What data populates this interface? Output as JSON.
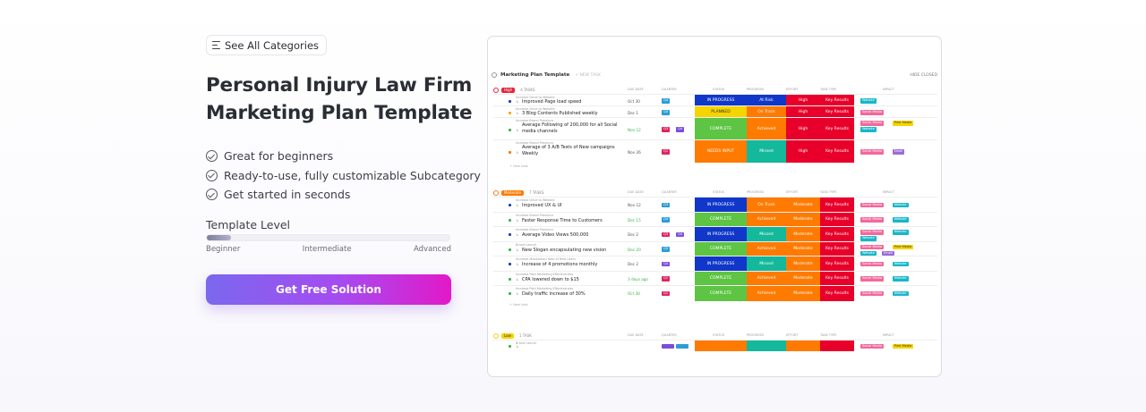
{
  "category_button": {
    "label": "See All Categories"
  },
  "title": "Personal Injury Law Firm Marketing Plan Template",
  "features": [
    "Great for beginners",
    "Ready-to-use, fully customizable Subcategory",
    "Get started in seconds"
  ],
  "template_level": {
    "label": "Template Level",
    "value_fraction": 0.1,
    "ticks": [
      "Beginner",
      "Intermediate",
      "Advanced"
    ]
  },
  "cta": {
    "label": "Get Free Solution"
  },
  "preview": {
    "title": "Marketing Plan Template",
    "subtitle": "+ NEW TASK",
    "hide_closed": "HIDE CLOSED",
    "columns": [
      "DUE DATE",
      "QUARTER",
      "STATUS",
      "PROGRESS",
      "EFFORT",
      "TASK TYPE",
      "IMPACT"
    ],
    "groups": [
      {
        "tag": "High",
        "tag_color": "#e5243b",
        "count": "4 TASKS",
        "rows": [
          {
            "cat": "Increase Drive to Website",
            "name": "Improved Page load speed",
            "dot": "#1f3fb5",
            "date": "Oct 30",
            "date_color": "#555",
            "q": [
              {
                "t": "Q4",
                "c": "#2b9cd8"
              }
            ],
            "status": "IN PROGRESS",
            "status_color": "#1037c9",
            "progress": "At Risk",
            "progress_color": "#1037c9",
            "effort": "High",
            "effort_color": "#e8002a",
            "type": "Key Results",
            "impact": [
              {
                "t": "Website",
                "c": "#18b6c9"
              }
            ]
          },
          {
            "cat": "Increase Drive to Website",
            "name": "3 Blog Contents Published weekly",
            "dot": "#f4a80b",
            "date": "Dec 1",
            "date_color": "#555",
            "q": [
              {
                "t": "Q4",
                "c": "#2b9cd8"
              }
            ],
            "status": "PLANNED",
            "status_color": "#f5d400",
            "progress": "On Track",
            "progress_color": "#ff7a00",
            "effort": "High",
            "effort_color": "#e8002a",
            "type": "Key Results",
            "impact": [
              {
                "t": "Social Media",
                "c": "#f2689b"
              }
            ]
          },
          {
            "cat": "Increase Brand Presence",
            "name": "Average Following of 200,000 for all Social media channels",
            "dot": "#3bb54a",
            "date": "Nov 12",
            "date_color": "#3bb54a",
            "q": [
              {
                "t": "Q3",
                "c": "#e0245e"
              },
              {
                "t": "Q4",
                "c": "#7b4ddb"
              }
            ],
            "status": "COMPLETE",
            "status_color": "#5ec444",
            "progress": "Achieved",
            "progress_color": "#ff7a00",
            "effort": "High",
            "effort_color": "#e8002a",
            "type": "Key Results",
            "impact": [
              {
                "t": "Social Media",
                "c": "#f2689b"
              },
              {
                "t": "Print Media",
                "c": "#f5d400"
              },
              {
                "t": "Website",
                "c": "#18b6c9"
              }
            ]
          },
          {
            "cat": "Increase Brand Presence",
            "name": "Average of 3 A/B Tests of New campaigns Weekly",
            "dot": "#f57c00",
            "date": "Nov 26",
            "date_color": "#555",
            "q": [
              {
                "t": "Q1",
                "c": "#e0245e"
              }
            ],
            "status": "NEEDS INPUT",
            "status_color": "#ff7a00",
            "progress": "Missed",
            "progress_color": "#14b89a",
            "effort": "High",
            "effort_color": "#e8002a",
            "type": "Key Results",
            "impact": [
              {
                "t": "Social Media",
                "c": "#f2689b"
              },
              {
                "t": "Email",
                "c": "#9b6ad8"
              }
            ]
          }
        ]
      },
      {
        "tag": "Moderate",
        "tag_color": "#ff7a00",
        "count": "7 TASKS",
        "rows": [
          {
            "cat": "Increase Drive to Website",
            "name": "Improved UX & UI",
            "dot": "#1f3fb5",
            "date": "Nov 12",
            "date_color": "#555",
            "q": [
              {
                "t": "Q3",
                "c": "#2b9cd8"
              }
            ],
            "status": "IN PROGRESS",
            "status_color": "#1037c9",
            "progress": "On Track",
            "progress_color": "#ff7a00",
            "effort": "Moderate",
            "effort_color": "#ff7a00",
            "type": "Key Results",
            "impact": [
              {
                "t": "Social Media",
                "c": "#f2689b"
              },
              {
                "t": "Website",
                "c": "#18b6c9"
              }
            ]
          },
          {
            "cat": "Increase Brand Presence",
            "name": "Faster Response Time to Customers",
            "dot": "#3bb54a",
            "date": "Dec 15",
            "date_color": "#3bb54a",
            "q": [
              {
                "t": "Q4",
                "c": "#2b9cd8"
              }
            ],
            "status": "COMPLETE",
            "status_color": "#5ec444",
            "progress": "Achieved",
            "progress_color": "#ff7a00",
            "effort": "Moderate",
            "effort_color": "#ff7a00",
            "type": "Key Results",
            "impact": [
              {
                "t": "Social Media",
                "c": "#f2689b"
              },
              {
                "t": "Website",
                "c": "#18b6c9"
              }
            ]
          },
          {
            "cat": "Increase Brand Presence",
            "name": "Average Video Views 500,000",
            "dot": "#1f3fb5",
            "date": "Dec 2",
            "date_color": "#555",
            "q": [
              {
                "t": "Q3",
                "c": "#e0245e"
              },
              {
                "t": "Q4",
                "c": "#7b4ddb"
              }
            ],
            "status": "IN PROGRESS",
            "status_color": "#1037c9",
            "progress": "Missed",
            "progress_color": "#14b89a",
            "effort": "Moderate",
            "effort_color": "#ff7a00",
            "type": "Key Results",
            "impact": [
              {
                "t": "Social Media",
                "c": "#f2689b"
              },
              {
                "t": "Website",
                "c": "#18b6c9"
              },
              {
                "t": "Website",
                "c": "#18b6c9"
              }
            ]
          },
          {
            "cat": "Brand Launch",
            "name": "New Slogan encapsulating new vision",
            "dot": "#3bb54a",
            "date": "Dec 20",
            "date_color": "#3bb54a",
            "q": [
              {
                "t": "Q3",
                "c": "#2b9cd8"
              }
            ],
            "status": "COMPLETE",
            "status_color": "#5ec444",
            "progress": "Achieved",
            "progress_color": "#ff7a00",
            "effort": "Moderate",
            "effort_color": "#ff7a00",
            "type": "Key Results",
            "impact": [
              {
                "t": "Social Media",
                "c": "#f2689b"
              },
              {
                "t": "Print Media",
                "c": "#f5d400"
              },
              {
                "t": "Website",
                "c": "#18b6c9"
              },
              {
                "t": "Email",
                "c": "#9b6ad8"
              }
            ]
          },
          {
            "cat": "Increase Moderation Rate of New Users",
            "name": "Increase of 4 promotions monthly",
            "dot": "#1f3fb5",
            "date": "Dec 2",
            "date_color": "#555",
            "q": [
              {
                "t": "Q4",
                "c": "#7b4ddb"
              }
            ],
            "status": "IN PROGRESS",
            "status_color": "#1037c9",
            "progress": "Missed",
            "progress_color": "#14b89a",
            "effort": "Moderate",
            "effort_color": "#ff7a00",
            "type": "Key Results",
            "impact": [
              {
                "t": "Social Media",
                "c": "#f2689b"
              },
              {
                "t": "Website",
                "c": "#18b6c9"
              }
            ]
          },
          {
            "cat": "Increase Paid Marketing Effectiveness",
            "name": "CPA lowered down to $15",
            "dot": "#3bb54a",
            "date": "3 days ago",
            "date_color": "#3bb54a",
            "q": [
              {
                "t": "Q1",
                "c": "#e0245e"
              }
            ],
            "status": "COMPLETE",
            "status_color": "#5ec444",
            "progress": "Achieved",
            "progress_color": "#ff7a00",
            "effort": "Moderate",
            "effort_color": "#ff7a00",
            "type": "Key Results",
            "impact": [
              {
                "t": "Social Media",
                "c": "#f2689b"
              },
              {
                "t": "Website",
                "c": "#18b6c9"
              }
            ]
          },
          {
            "cat": "Increase Paid Marketing Effectiveness",
            "name": "Daily traffic increase of 30%",
            "dot": "#3bb54a",
            "date": "Oct 30",
            "date_color": "#3bb54a",
            "q": [
              {
                "t": "Q1",
                "c": "#e0245e"
              }
            ],
            "status": "COMPLETE",
            "status_color": "#5ec444",
            "progress": "Achieved",
            "progress_color": "#ff7a00",
            "effort": "Moderate",
            "effort_color": "#ff7a00",
            "type": "Key Results",
            "impact": [
              {
                "t": "Social Media",
                "c": "#f2689b"
              },
              {
                "t": "Website",
                "c": "#18b6c9"
              }
            ]
          }
        ]
      },
      {
        "tag": "Low",
        "tag_color": "#f5d400",
        "count": "1 TASK",
        "rows": [
          {
            "cat": "Brand Launch",
            "name": "",
            "dot": "#3bb54a",
            "date": "",
            "date_color": "#555",
            "q": [
              {
                "t": "",
                "c": "#7b4ddb"
              },
              {
                "t": "",
                "c": "#2b9cd8"
              }
            ],
            "status": "",
            "status_color": "#ff7a00",
            "progress": "",
            "progress_color": "#14b89a",
            "effort": "",
            "effort_color": "#ff7a00",
            "type": "",
            "impact": [
              {
                "t": "Social Media",
                "c": "#f2689b"
              },
              {
                "t": "Print Media",
                "c": "#f5d400"
              }
            ]
          }
        ]
      }
    ],
    "new_task": "+ New task"
  }
}
